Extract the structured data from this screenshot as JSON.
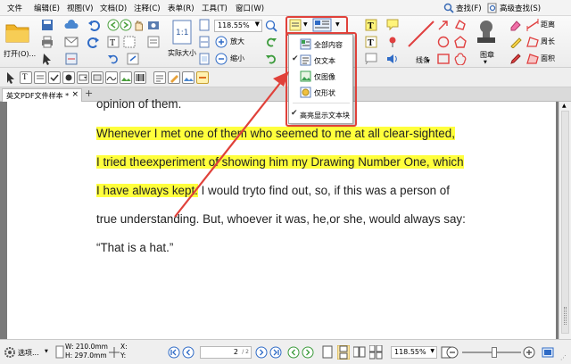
{
  "menubar": {
    "items": [
      "文件",
      "编辑(E)",
      "视图(V)",
      "文档(D)",
      "注释(C)",
      "表单(R)",
      "工具(T)",
      "窗口(W)"
    ],
    "search_label": "查找(F)",
    "advanced_search_label": "高级查找(S)"
  },
  "ribbon": {
    "open_label": "打开(O)...",
    "zoom_value": "118.55%",
    "actual_size_label": "实际大小",
    "zoom_in_label": "放大",
    "zoom_out_label": "缩小",
    "stamp_label": "图章",
    "line_label": "线条",
    "distance_label": "距离",
    "perimeter_label": "周长",
    "area_label": "面积",
    "page_badge_label": "1:1"
  },
  "dropdown": {
    "items": [
      {
        "label": "全部内容",
        "checked": false
      },
      {
        "label": "仅文本",
        "checked": true
      },
      {
        "label": "仅图像",
        "checked": false
      },
      {
        "label": "仅形状",
        "checked": false
      }
    ],
    "highlight_label": "高亮显示文本块",
    "highlight_checked": true
  },
  "tab": {
    "title": "英文PDF文件样本 *",
    "close": "×",
    "new": "+"
  },
  "document": {
    "lines": [
      {
        "text": "opinion of them.",
        "highlighted": false
      },
      {
        "text": "Whenever I met one of them who seemed to me at all clear-sighted,",
        "highlighted": true
      },
      {
        "text": "I tried theexperiment of showing him my Drawing Number One, which",
        "highlighted": true
      },
      {
        "text": "I have always kept.",
        "highlighted": true,
        "rest": " I would tryto find out, so,     if this was a person of"
      },
      {
        "text": "true understanding. But, whoever it was,     he,or she, would always say:",
        "highlighted": false
      },
      {
        "text": "“That is a hat.”",
        "highlighted": false
      }
    ]
  },
  "statusbar": {
    "options_label": "选项...",
    "width_label": "W: 210.0mm",
    "height_label": "H: 297.0mm",
    "x_label": "X:",
    "y_label": "Y:",
    "page_value": "2",
    "page_total": "/ 2",
    "zoom_value": "118.55%"
  },
  "colors": {
    "highlight": "#ffff3c",
    "annotation_red": "#e0413a",
    "ribbon_bg": "#ececec",
    "doc_bg": "#7a7a7a"
  }
}
